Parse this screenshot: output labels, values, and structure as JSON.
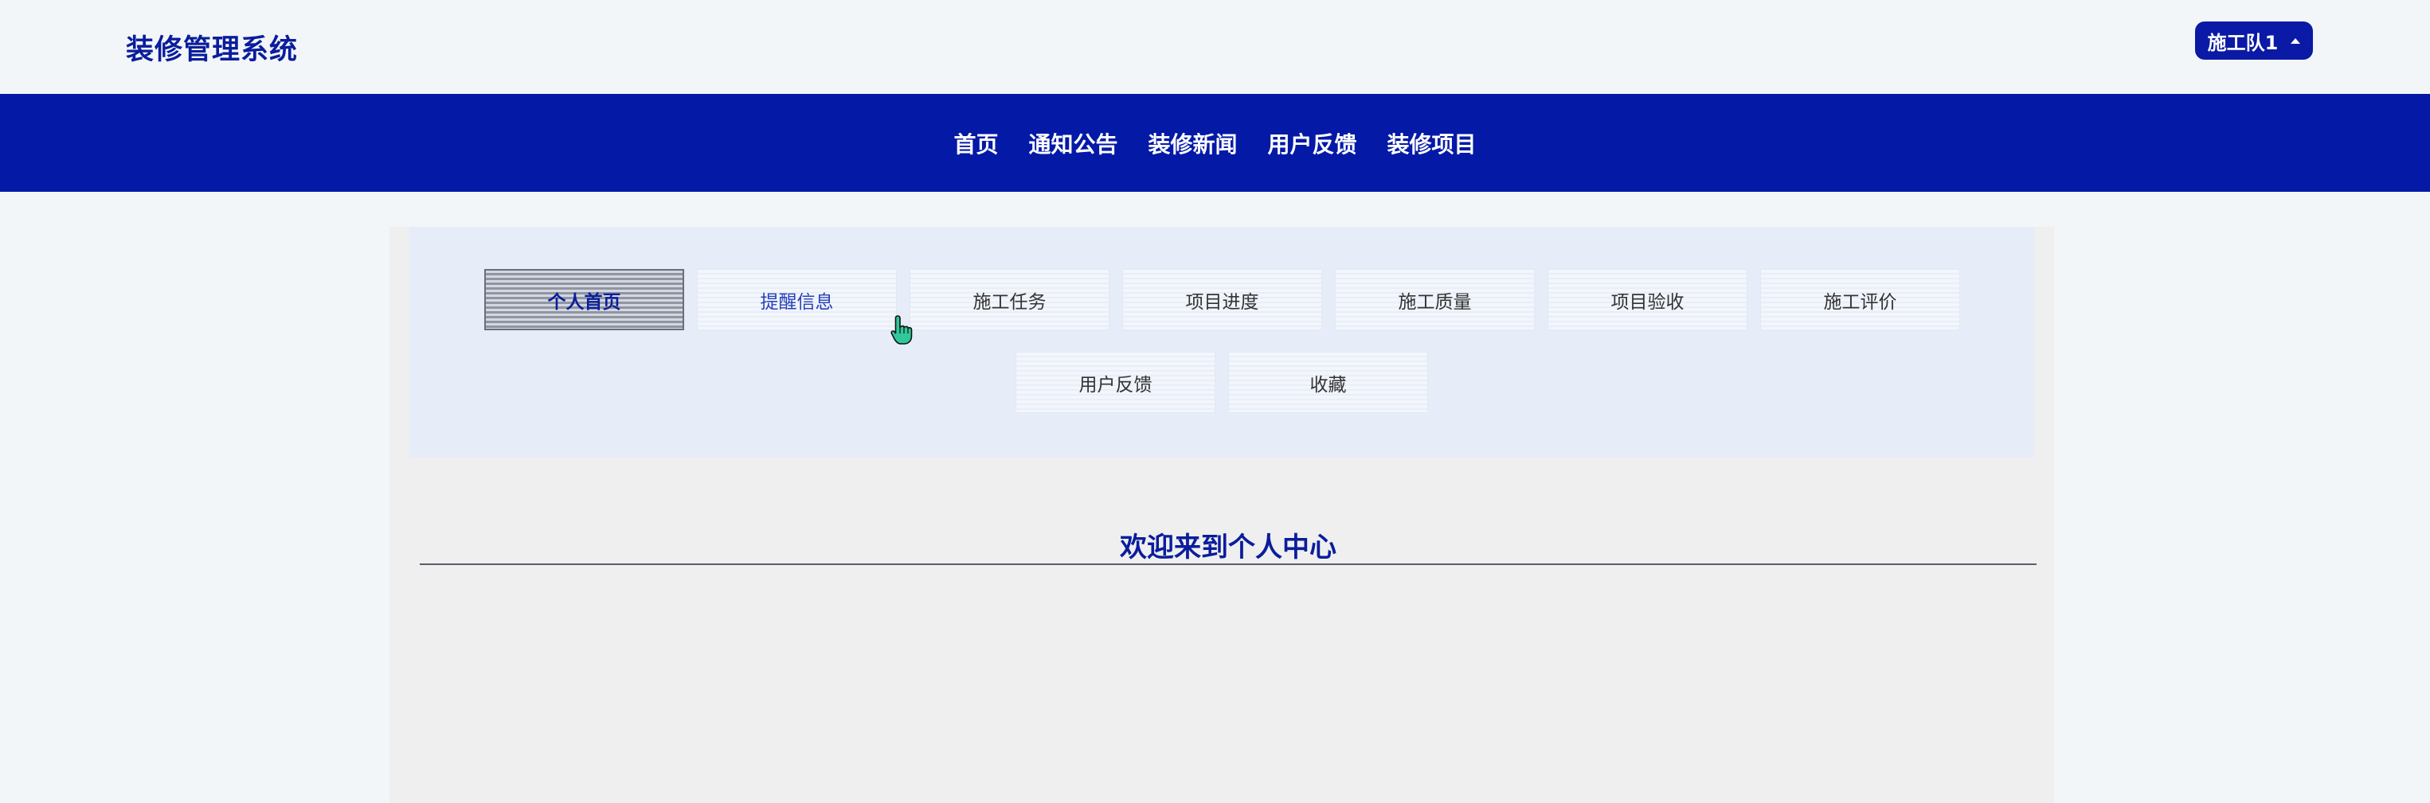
{
  "header": {
    "logo": "装修管理系统",
    "user_menu_label": "施工队1"
  },
  "nav": {
    "items": [
      "首页",
      "通知公告",
      "装修新闻",
      "用户反馈",
      "装修项目"
    ]
  },
  "tabs": [
    {
      "label": "个人首页",
      "active": true
    },
    {
      "label": "提醒信息",
      "active": false,
      "hover": true
    },
    {
      "label": "施工任务",
      "active": false
    },
    {
      "label": "项目进度",
      "active": false
    },
    {
      "label": "施工质量",
      "active": false
    },
    {
      "label": "项目验收",
      "active": false
    },
    {
      "label": "施工评价",
      "active": false
    },
    {
      "label": "用户反馈",
      "active": false
    },
    {
      "label": "收藏",
      "active": false
    }
  ],
  "main": {
    "welcome_title": "欢迎来到个人中心"
  },
  "colors": {
    "brand": "#0419a6",
    "title": "#0a1d9c",
    "page_bg": "#f3f6f8",
    "panel_bg": "#efefef",
    "tab_panel_bg": "#e6ecf8"
  }
}
